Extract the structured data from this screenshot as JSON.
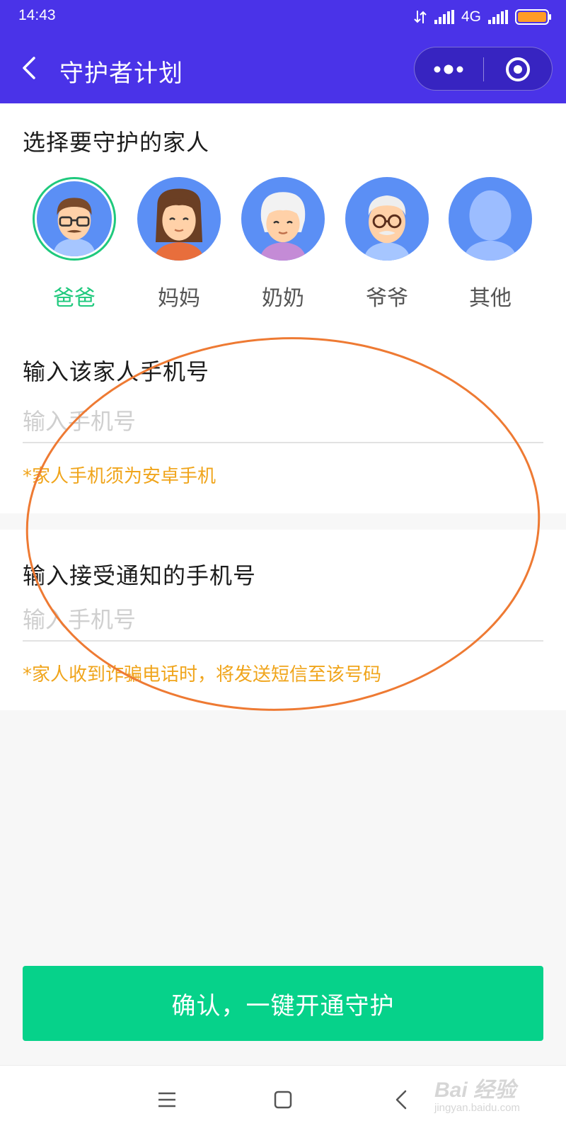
{
  "status_bar": {
    "time": "14:43",
    "network": "4G",
    "battery_level": 0.95,
    "battery_color": "#ff9c26"
  },
  "nav": {
    "back_icon": "chevron-left-icon",
    "title": "守护者计划",
    "more_icon": "more-dots-icon",
    "close_icon": "target-close-icon"
  },
  "family_section": {
    "title": "选择要守护的家人",
    "members": [
      {
        "name": "爸爸",
        "icon": "dad-avatar-icon",
        "selected": true
      },
      {
        "name": "妈妈",
        "icon": "mom-avatar-icon",
        "selected": false
      },
      {
        "name": "奶奶",
        "icon": "grandma-avatar-icon",
        "selected": false
      },
      {
        "name": "爷爷",
        "icon": "grandpa-avatar-icon",
        "selected": false
      },
      {
        "name": "其他",
        "icon": "other-avatar-icon",
        "selected": false
      }
    ]
  },
  "family_phone": {
    "label": "输入该家人手机号",
    "placeholder": "输入手机号",
    "value": "",
    "hint": "*家人手机须为安卓手机"
  },
  "notify_phone": {
    "label": "输入接受通知的手机号",
    "placeholder": "输入手机号",
    "value": "",
    "hint": "*家人收到诈骗电话时，将发送短信至该号码"
  },
  "confirm_button": {
    "label": "确认，一键开通守护"
  },
  "system_nav": {
    "menu_icon": "menu-icon",
    "home_icon": "home-square-icon",
    "back_icon": "back-triangle-icon"
  },
  "watermark": {
    "main": "Bai 经验",
    "sub": "jingyan.baidu.com"
  },
  "colors": {
    "header": "#4a33e8",
    "accent_green": "#06d28a",
    "selected_green": "#1fc97d",
    "hint_orange": "#f0a51c",
    "annotation": "#ee7a33",
    "avatar_bg": "#5b8ff5"
  }
}
